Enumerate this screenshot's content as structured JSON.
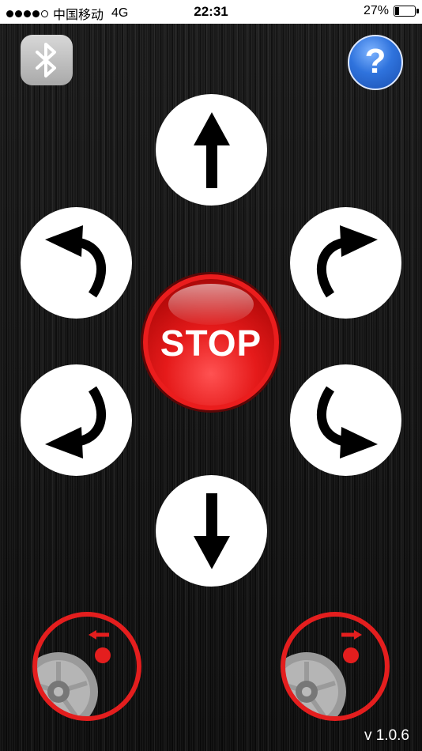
{
  "status_bar": {
    "signal_dots": 5,
    "signal_filled": 4,
    "carrier": "中国移动",
    "network": "4G",
    "time": "22:31",
    "battery_percent_label": "27%",
    "battery_level": 0.27
  },
  "toolbar": {
    "bluetooth_icon": "bluetooth-icon",
    "help_label": "?"
  },
  "controls": {
    "stop_label": "STOP",
    "directions": [
      "forward",
      "forward-left",
      "forward-right",
      "backward-left",
      "backward-right",
      "backward"
    ]
  },
  "wheels": {
    "left_icon": "wheel-reverse-icon",
    "right_icon": "wheel-forward-icon",
    "accent_color": "#e41e1e",
    "wheel_color": "#9a9a9a"
  },
  "version": "v 1.0.6"
}
